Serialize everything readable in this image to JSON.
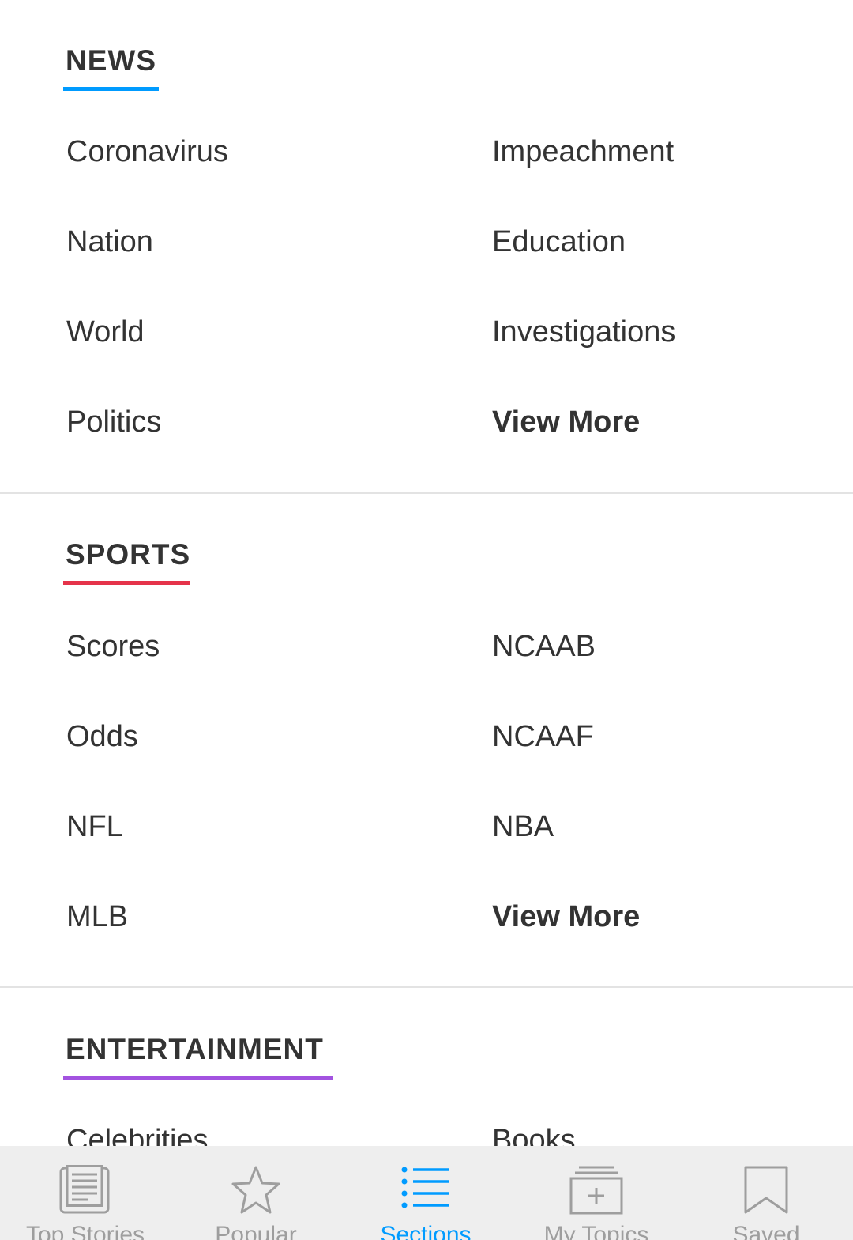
{
  "sections": [
    {
      "title": "NEWS",
      "accent": "#009bff",
      "items": [
        "Coronavirus",
        "Impeachment",
        "Nation",
        "Education",
        "World",
        "Investigations",
        "Politics",
        "View More"
      ]
    },
    {
      "title": "SPORTS",
      "accent": "#e5334a",
      "items": [
        "Scores",
        "NCAAB",
        "Odds",
        "NCAAF",
        "NFL",
        "NBA",
        "MLB",
        "View More"
      ]
    },
    {
      "title": "ENTERTAINMENT",
      "accent": "#a353e0",
      "items": [
        "Celebrities",
        "Books"
      ]
    }
  ],
  "tabbar": {
    "active_color": "#009bff",
    "inactive_color": "#9e9e9e",
    "tabs": [
      {
        "label": "Top Stories",
        "icon": "newspaper-icon"
      },
      {
        "label": "Popular",
        "icon": "star-icon"
      },
      {
        "label": "Sections",
        "icon": "list-icon"
      },
      {
        "label": "My Topics",
        "icon": "add-topics-icon"
      },
      {
        "label": "Saved",
        "icon": "bookmark-icon"
      }
    ]
  }
}
